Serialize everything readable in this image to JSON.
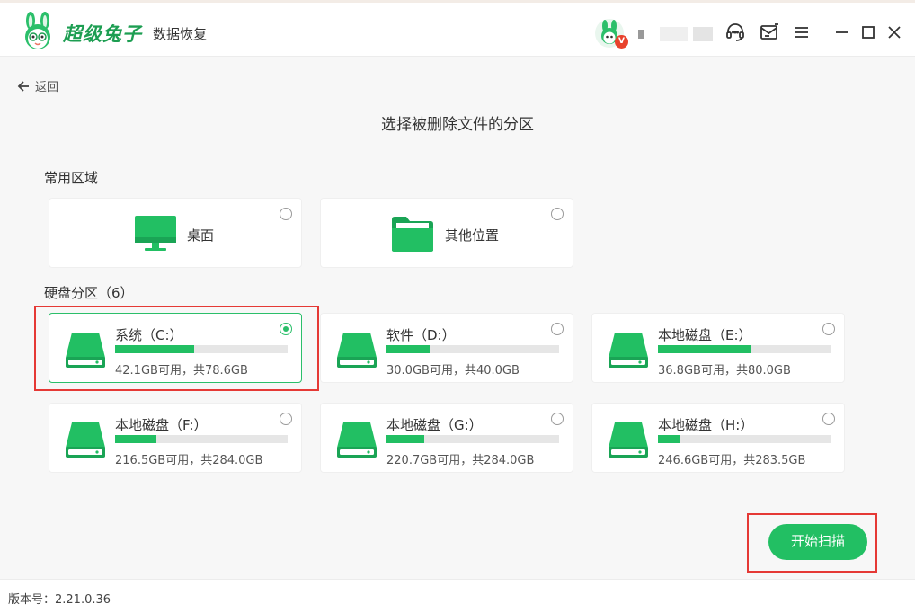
{
  "app": {
    "brand": "超级兔子",
    "product": "数据恢复",
    "vip_badge": "V"
  },
  "header": {
    "icons": [
      "support-chat-icon",
      "message-icon",
      "menu-icon",
      "minimize-icon",
      "maximize-icon",
      "close-icon"
    ]
  },
  "nav": {
    "back_label": "返回"
  },
  "page": {
    "title": "选择被删除文件的分区"
  },
  "common": {
    "label": "常用区域",
    "items": [
      {
        "label": "桌面",
        "icon": "monitor-icon"
      },
      {
        "label": "其他位置",
        "icon": "folder-icon"
      }
    ]
  },
  "disks": {
    "label": "硬盘分区（6）",
    "items": [
      {
        "name": "系统（C:）",
        "info": "42.1GB可用，共78.6GB",
        "used_fraction": 0.46,
        "selected": true
      },
      {
        "name": "软件（D:）",
        "info": "30.0GB可用，共40.0GB",
        "used_fraction": 0.25,
        "selected": false
      },
      {
        "name": "本地磁盘（E:）",
        "info": "36.8GB可用，共80.0GB",
        "used_fraction": 0.54,
        "selected": false
      },
      {
        "name": "本地磁盘（F:）",
        "info": "216.5GB可用，共284.0GB",
        "used_fraction": 0.24,
        "selected": false
      },
      {
        "name": "本地磁盘（G:）",
        "info": "220.7GB可用，共284.0GB",
        "used_fraction": 0.22,
        "selected": false
      },
      {
        "name": "本地磁盘（H:）",
        "info": "246.6GB可用，共283.5GB",
        "used_fraction": 0.13,
        "selected": false
      }
    ]
  },
  "actions": {
    "scan_label": "开始扫描"
  },
  "footer": {
    "version": "版本号：2.21.0.36"
  },
  "colors": {
    "accent": "#22bf63",
    "highlight": "#e53935",
    "brand": "#1d9e52"
  }
}
